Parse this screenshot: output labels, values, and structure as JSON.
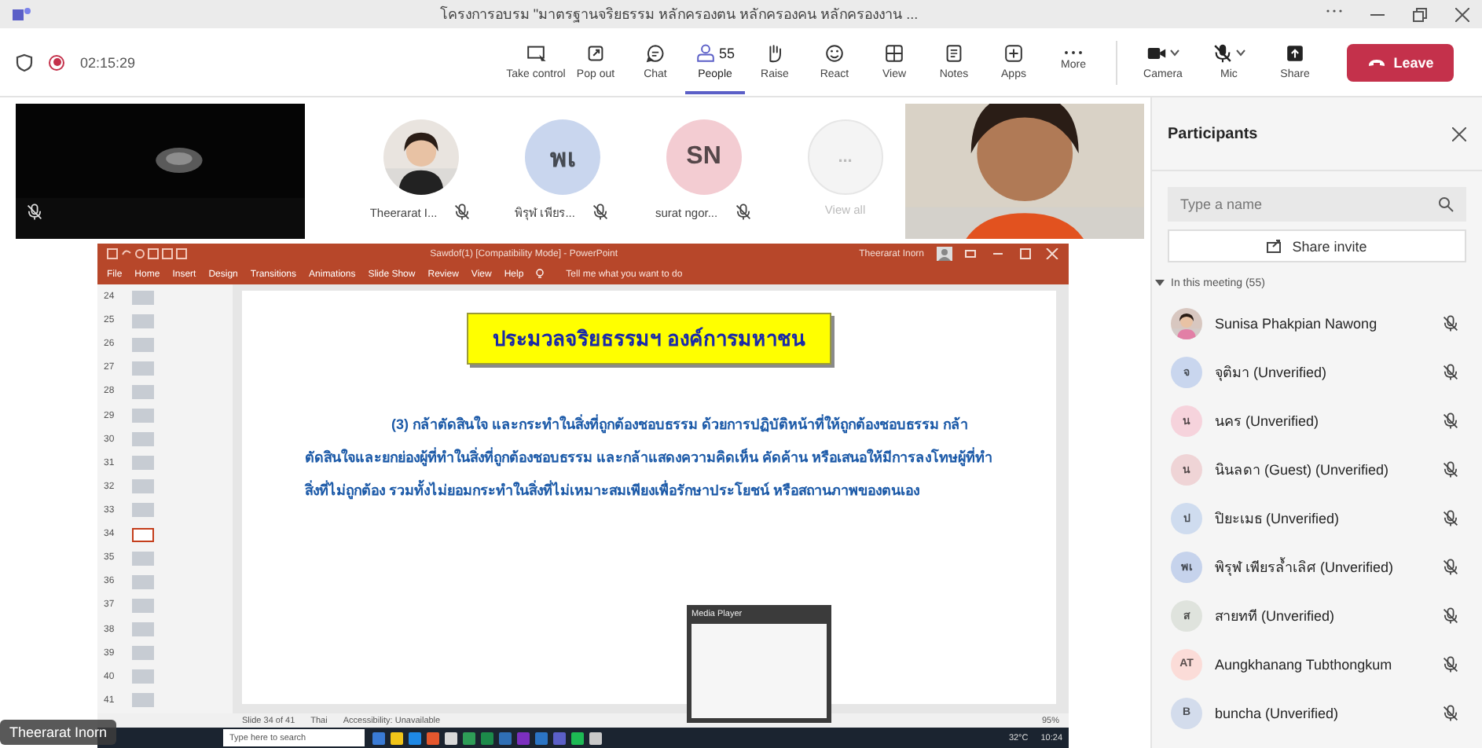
{
  "title_bar": {
    "title": "โครงการอบรม \"มาตรฐานจริยธรรม หลักครองตน หลักครองคน หลักครองงาน ..."
  },
  "toolbar": {
    "timer": "02:15:29",
    "recording": true,
    "buttons": [
      {
        "kind": "take-control",
        "label": "Take control",
        "selected": false
      },
      {
        "kind": "pop-out",
        "label": "Pop out",
        "selected": false
      },
      {
        "kind": "chat",
        "label": "Chat",
        "selected": false
      },
      {
        "kind": "people",
        "label": "People",
        "count": "55",
        "selected": true
      },
      {
        "kind": "raise",
        "label": "Raise",
        "selected": false
      },
      {
        "kind": "react",
        "label": "React",
        "selected": false
      },
      {
        "kind": "view",
        "label": "View",
        "selected": false
      },
      {
        "kind": "notes",
        "label": "Notes",
        "selected": false
      },
      {
        "kind": "apps",
        "label": "Apps",
        "selected": false
      },
      {
        "kind": "more",
        "label": "More",
        "selected": false
      }
    ],
    "devices": [
      {
        "kind": "camera",
        "label": "Camera"
      },
      {
        "kind": "mic",
        "label": "Mic"
      },
      {
        "kind": "share",
        "label": "Share"
      }
    ],
    "leave": "Leave"
  },
  "stage": {
    "avatars": [
      {
        "name": "Theerarat I...",
        "muted": true
      },
      {
        "kind": "initials",
        "initials": "พเ",
        "color": "#c9d6ee",
        "name": "พิรุฬ เพียร...",
        "muted": true
      },
      {
        "kind": "initials",
        "initials": "SN",
        "color": "#f3ccd2",
        "name": "surat ngor...",
        "muted": true
      },
      {
        "kind": "more",
        "initials": "...",
        "name": "View all"
      }
    ]
  },
  "shared_screen": {
    "title": "Sawdof(1) [Compatibility Mode] - PowerPoint",
    "user": "Theerarat Inorn",
    "tabs": [
      "File",
      "Home",
      "Insert",
      "Design",
      "Transitions",
      "Animations",
      "Slide Show",
      "Review",
      "View",
      "Help"
    ],
    "tell_me": "Tell me what you want to do",
    "slides": [
      {
        "number": "24",
        "selected": false
      },
      {
        "number": "25",
        "selected": false
      },
      {
        "number": "26",
        "selected": false
      },
      {
        "number": "27",
        "selected": false
      },
      {
        "number": "28",
        "selected": false
      },
      {
        "number": "29",
        "selected": false
      },
      {
        "number": "30",
        "selected": false
      },
      {
        "number": "31",
        "selected": false
      },
      {
        "number": "32",
        "selected": false
      },
      {
        "number": "33",
        "selected": false
      },
      {
        "number": "34",
        "selected": true
      },
      {
        "number": "35",
        "selected": false
      },
      {
        "number": "36",
        "selected": false
      },
      {
        "number": "37",
        "selected": false
      },
      {
        "number": "38",
        "selected": false
      },
      {
        "number": "39",
        "selected": false
      },
      {
        "number": "40",
        "selected": false
      },
      {
        "number": "41",
        "selected": false
      }
    ],
    "slide": {
      "heading": "ประมวลจริยธรรมฯ องค์การมหาชน",
      "body": "(3) กล้าตัดสินใจ และกระทำในสิ่งที่ถูกต้องชอบธรรม ด้วยการปฏิบัติหน้าที่ให้ถูกต้องชอบธรรม กล้าตัดสินใจและยกย่องผู้ที่ทำในสิ่งที่ถูกต้องชอบธรรม และกล้าแสดงความคิดเห็น คัดค้าน หรือเสนอให้มีการลงโทษผู้ที่ทำสิ่งที่ไม่ถูกต้อง รวมทั้งไม่ยอมกระทำในสิ่งที่ไม่เหมาะสมเพียงเพื่อรักษาประโยชน์ หรือสถานภาพของตนเอง"
    },
    "status": [
      "Slide 34 of 41",
      "Thai",
      "Accessibility: Unavailable"
    ],
    "zoom": "95%",
    "media_player": {
      "title": "Media Player"
    },
    "taskbar": {
      "search": {
        "placeholder": "Type here to search"
      },
      "weather": "32°C",
      "time": "10:24"
    },
    "presenter": "Theerarat Inorn"
  },
  "participants": {
    "title": "Participants",
    "search": {
      "placeholder": "Type a name"
    },
    "share_invite": "Share invite",
    "section": "In this meeting (55)",
    "expanded": true,
    "people": [
      {
        "name": "Sunisa Phakpian Nawong",
        "muted": true
      },
      {
        "kind": "initials",
        "initials": "จ",
        "color": "#c9d6ee",
        "name": "จุติมา (Unverified)",
        "muted": true
      },
      {
        "kind": "initials",
        "initials": "น",
        "color": "#f6d3dc",
        "name": "นคร (Unverified)",
        "muted": true
      },
      {
        "kind": "initials",
        "initials": "น",
        "color": "#efd4d6",
        "name": "นินลดา (Guest) (Unverified)",
        "muted": true
      },
      {
        "kind": "initials",
        "initials": "ป",
        "color": "#cfdcef",
        "name": "ปิยะเมธ (Unverified)",
        "muted": true
      },
      {
        "kind": "initials",
        "initials": "พเ",
        "color": "#c6d3ec",
        "name": "พิรุฬ เพียรล้ำเลิศ (Unverified)",
        "muted": true
      },
      {
        "kind": "initials",
        "initials": "ส",
        "color": "#dfe3dd",
        "name": "สายทที (Unverified)",
        "muted": true
      },
      {
        "kind": "initials",
        "initials": "AT",
        "color": "#fbdcd8",
        "name": "Aungkhanang Tubthongkum",
        "muted": true
      },
      {
        "kind": "initials",
        "initials": "B",
        "color": "#d3dcec",
        "name": "buncha (Unverified)",
        "muted": true
      }
    ]
  }
}
